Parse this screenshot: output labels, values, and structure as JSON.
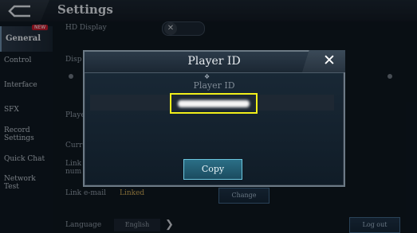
{
  "header": {
    "title": "Settings"
  },
  "sidebar": {
    "items": [
      {
        "label": "General",
        "active": true,
        "badge": "NEW"
      },
      {
        "label": "Control"
      },
      {
        "label": "Interface"
      },
      {
        "label": "SFX"
      },
      {
        "label": "Record Settings"
      },
      {
        "label": "Quick Chat"
      },
      {
        "label": "Network Test"
      }
    ]
  },
  "content": {
    "hd_display_label": "HD Display",
    "display_label_partial": "Disp",
    "player_label_partial": "Playe",
    "current_label_partial": "Curr",
    "link_number_label_partial": "Link num",
    "link_email_label": "Link e-mail",
    "link_email_status": "Linked",
    "change_button": "Change",
    "language_label": "Language",
    "language_value": "English",
    "logout_button": "Log out"
  },
  "dialog": {
    "title": "Player ID",
    "field_label": "Player ID",
    "copy_button": "Copy"
  },
  "colors": {
    "highlight": "#f1ef1a",
    "linked": "#c8a454",
    "copy_button": "#2b6f86",
    "new_badge": "#c0192b"
  }
}
